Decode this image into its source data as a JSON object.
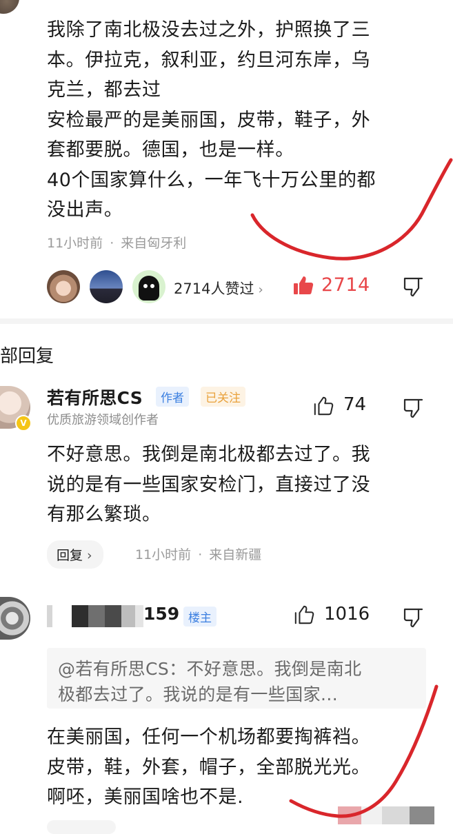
{
  "top_comment": {
    "lines": [
      "我除了南北极没去过之外，护照换了三",
      "本。伊拉克，叙利亚，约旦河东岸，乌",
      "克兰，都去过",
      "安检最严的是美丽国，皮带，鞋子，外",
      "套都要脱。德国，也是一样。",
      "40个国家算什么，一年飞十万公里的都",
      "没出声。"
    ],
    "time": "11小时前",
    "dot": "·",
    "location": "来自匈牙利",
    "likers_text": "2714人赞过",
    "likers_chevron": "›",
    "like_count": "2714"
  },
  "section": {
    "title": "部回复"
  },
  "reply1": {
    "name": "若有所思CS",
    "badge_author": "作者",
    "badge_follow": "已关注",
    "verified_mark": "V",
    "subtitle": "优质旅游领域创作者",
    "like_count": "74",
    "lines": [
      "不好意思。我倒是南北极都去过了。我",
      "说的是有一些国家安检门，直接过了没",
      "有那么繁琐。"
    ],
    "reply_label": "回复",
    "reply_chevron": "›",
    "time": "11小时前",
    "dot": "·",
    "location": "来自新疆"
  },
  "reply2": {
    "name_visible_tail": "159",
    "badge_op": "楼主",
    "like_count": "1016",
    "quote_lines": [
      "@若有所思CS：不好意思。我倒是南北",
      "极都去过了。我说的是有一些国家..."
    ],
    "lines": [
      "在美丽国，任何一个机场都要掏裤裆。",
      "皮带，鞋，外套，帽子，全部脱光光。",
      "啊呸，美丽国啥也不是."
    ]
  },
  "colors": {
    "accent_red": "#e8474a",
    "author_badge": "#3b7fe0",
    "follow_badge": "#e9a13b",
    "meta_gray": "#9a9a9a",
    "pen_red": "#d9262b"
  },
  "icons": {
    "like_filled": "thumbs-up-filled-icon",
    "like_outline": "thumbs-up-outline-icon",
    "dislike": "thumbs-down-outline-icon"
  }
}
